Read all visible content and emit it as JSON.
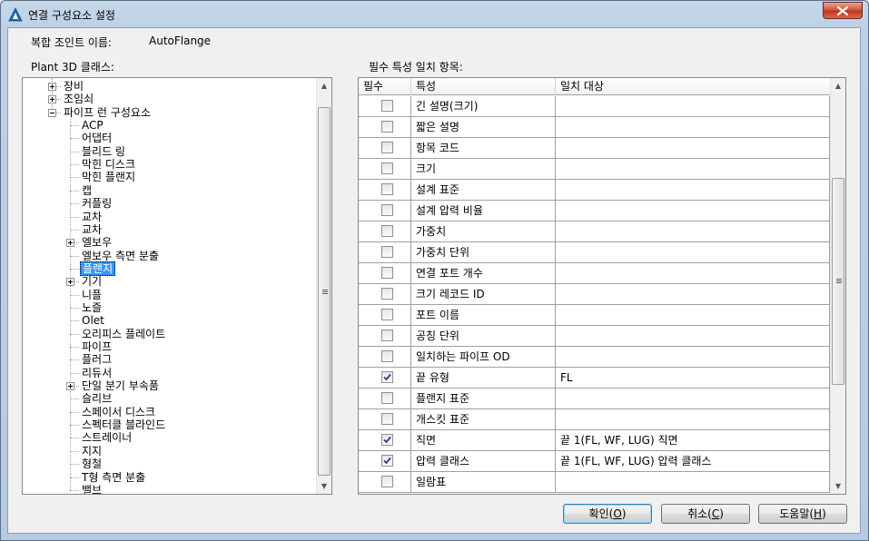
{
  "window": {
    "title": "연결 구성요소 설정"
  },
  "composite_joint": {
    "label": "복합 조인트 이름:",
    "value": "AutoFlange"
  },
  "tree": {
    "label": "Plant 3D 클래스:",
    "items": [
      {
        "label": "장비",
        "depth": 0,
        "expander": "plus"
      },
      {
        "label": "조임쇠",
        "depth": 0,
        "expander": "plus"
      },
      {
        "label": "파이프 런 구성요소",
        "depth": 0,
        "expander": "minus"
      },
      {
        "label": "ACP",
        "depth": 1,
        "expander": ""
      },
      {
        "label": "어댑터",
        "depth": 1,
        "expander": ""
      },
      {
        "label": "블리드 링",
        "depth": 1,
        "expander": ""
      },
      {
        "label": "막힌 디스크",
        "depth": 1,
        "expander": ""
      },
      {
        "label": "막힌 플랜지",
        "depth": 1,
        "expander": ""
      },
      {
        "label": "캡",
        "depth": 1,
        "expander": ""
      },
      {
        "label": "커플링",
        "depth": 1,
        "expander": ""
      },
      {
        "label": "교차",
        "depth": 1,
        "expander": ""
      },
      {
        "label": "교차",
        "depth": 1,
        "expander": ""
      },
      {
        "label": "엘보우",
        "depth": 1,
        "expander": "plus"
      },
      {
        "label": "엘보우 측면 분출",
        "depth": 1,
        "expander": ""
      },
      {
        "label": "플랜지",
        "depth": 1,
        "expander": "",
        "selected": true
      },
      {
        "label": "기기",
        "depth": 1,
        "expander": "plus"
      },
      {
        "label": "니플",
        "depth": 1,
        "expander": ""
      },
      {
        "label": "노즐",
        "depth": 1,
        "expander": ""
      },
      {
        "label": "Olet",
        "depth": 1,
        "expander": ""
      },
      {
        "label": "오리피스 플레이트",
        "depth": 1,
        "expander": ""
      },
      {
        "label": "파이프",
        "depth": 1,
        "expander": ""
      },
      {
        "label": "플러그",
        "depth": 1,
        "expander": ""
      },
      {
        "label": "리듀서",
        "depth": 1,
        "expander": ""
      },
      {
        "label": "단일 분기 부속품",
        "depth": 1,
        "expander": "plus"
      },
      {
        "label": "슬리브",
        "depth": 1,
        "expander": ""
      },
      {
        "label": "스페이서 디스크",
        "depth": 1,
        "expander": ""
      },
      {
        "label": "스펙터클 블라인드",
        "depth": 1,
        "expander": ""
      },
      {
        "label": "스트레이너",
        "depth": 1,
        "expander": ""
      },
      {
        "label": "지지",
        "depth": 1,
        "expander": ""
      },
      {
        "label": "형철",
        "depth": 1,
        "expander": ""
      },
      {
        "label": "T형 측면 분출",
        "depth": 1,
        "expander": ""
      },
      {
        "label": "밸브",
        "depth": 1,
        "expander": ""
      }
    ]
  },
  "grid": {
    "label": "필수 특성 일치 항목:",
    "headers": {
      "required": "필수",
      "property": "특성",
      "match": "일치 대상"
    },
    "rows": [
      {
        "checked": false,
        "property": "긴 설명(크기)",
        "match": ""
      },
      {
        "checked": false,
        "property": "짧은 설명",
        "match": ""
      },
      {
        "checked": false,
        "property": "항목 코드",
        "match": ""
      },
      {
        "checked": false,
        "property": "크기",
        "match": ""
      },
      {
        "checked": false,
        "property": "설계 표준",
        "match": ""
      },
      {
        "checked": false,
        "property": "설계 압력 비율",
        "match": ""
      },
      {
        "checked": false,
        "property": "가중치",
        "match": ""
      },
      {
        "checked": false,
        "property": "가중치 단위",
        "match": ""
      },
      {
        "checked": false,
        "property": "연결 포트 개수",
        "match": ""
      },
      {
        "checked": false,
        "property": "크기 레코드 ID",
        "match": ""
      },
      {
        "checked": false,
        "property": "포트 이름",
        "match": ""
      },
      {
        "checked": false,
        "property": "공칭 단위",
        "match": ""
      },
      {
        "checked": false,
        "property": "일치하는 파이프 OD",
        "match": ""
      },
      {
        "checked": true,
        "property": "끝 유형",
        "match": "FL"
      },
      {
        "checked": false,
        "property": "플랜지 표준",
        "match": ""
      },
      {
        "checked": false,
        "property": "개스킷 표준",
        "match": ""
      },
      {
        "checked": true,
        "property": "직면",
        "match": "끝 1(FL, WF, LUG) 직면"
      },
      {
        "checked": true,
        "property": "압력 클래스",
        "match": "끝 1(FL, WF, LUG) 압력 클래스"
      },
      {
        "checked": false,
        "property": "일람표",
        "match": ""
      }
    ]
  },
  "buttons": {
    "ok": {
      "text": "확인(",
      "key": "O",
      "end": ")"
    },
    "cancel": {
      "text": "취소(",
      "key": "C",
      "end": ")"
    },
    "help": {
      "text": "도움말(",
      "key": "H",
      "end": ")"
    }
  },
  "colors": {
    "selection": "#3399ff",
    "title_bar": "#bcd0e6",
    "close_button": "#c0381e"
  }
}
